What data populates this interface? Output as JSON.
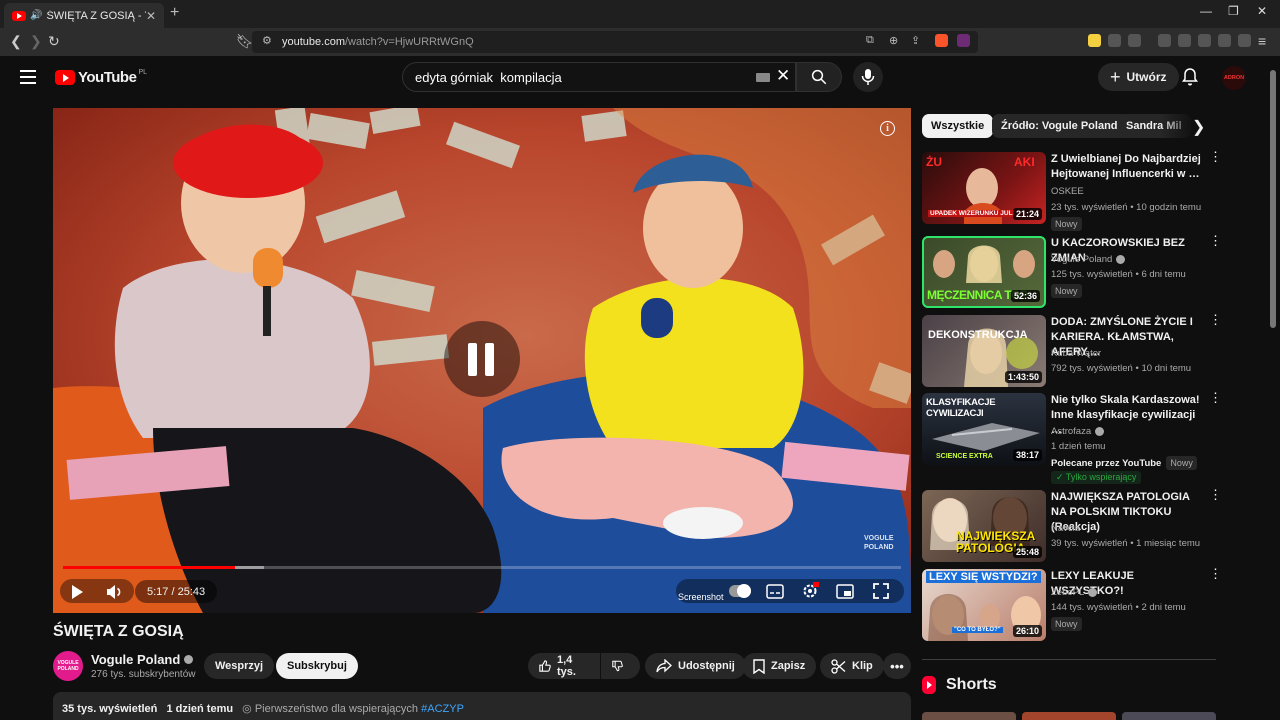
{
  "browser": {
    "tab_title": "ŚWIĘTA Z GOSIĄ - YouTube",
    "url_host": "youtube.com",
    "url_path": "/watch?v=HjwURRtWGnQ"
  },
  "header": {
    "logo_text": "YouTube",
    "region": "PL",
    "search_value": "edyta górniak  kompilacja",
    "create_label": "Utwórz",
    "account_initials": "ADRON"
  },
  "player": {
    "current_time": "5:17",
    "duration": "25:43",
    "time_separator": " / ",
    "progress_fraction": 0.205,
    "buffered_fraction": 0.24,
    "screenshot_label": "Screenshot",
    "watermark_line1": "VOGULE",
    "watermark_line2": "POLAND",
    "state": "playing"
  },
  "video": {
    "title": "ŚWIĘTA Z GOSIĄ",
    "channel": "Vogule Poland",
    "channel_avatar_text": "VOGULE POLAND",
    "subscribers": "276 tys. subskrybentów",
    "support_label": "Wesprzyj",
    "subscribe_label": "Subskrybuj",
    "likes": "1,4 tys.",
    "share_label": "Udostępnij",
    "save_label": "Zapisz",
    "clip_label": "Klip",
    "views": "35 tys. wyświetleń",
    "published": "1 dzień temu",
    "members_first": "Pierwszeństwo dla wspierających",
    "hashtag": "#ACZYP"
  },
  "sidebar": {
    "chips": [
      "Wszystkie",
      "Źródło: Vogule Poland",
      "Sandra Mil"
    ],
    "recommendations": [
      {
        "title": "Z Uwielbianej Do Najbardziej Hejtowanej Influencerki w …",
        "channel": "OSKEE",
        "meta": "23 tys. wyświetleń • 10 godzin temu",
        "badge": "Nowy",
        "duration": "21:24",
        "thumb_text": "UPADEK WIZERUNKU JULI"
      },
      {
        "title": "U KACZOROWSKIEJ BEZ ZMIAN",
        "channel": "Vogule Poland",
        "meta": "125 tys. wyświetleń • 6 dni temu",
        "badge": "Nowy",
        "duration": "52:36",
        "thumb_text": "MĘCZENNICA TOP"
      },
      {
        "title": "DODA: ZMYŚLONE ŻYCIE I KARIERA. KŁAMSTWA, AFERY,…",
        "channel": "Kuba Wątor",
        "meta": "792 tys. wyświetleń • 10 dni temu",
        "duration": "1:43:50",
        "thumb_text": "DEKONSTRUKCJA"
      },
      {
        "title": "Nie tylko Skala Kardaszowa! Inne klasyfikacje cywilizacji …",
        "channel": "Astrofaza",
        "meta": "1 dzień temu",
        "promo": "Polecane przez YouTube",
        "badge": "Nowy",
        "member": "Tylko wspierający",
        "duration": "38:17",
        "thumb_text": "KLASYFIKACJE CYWILIZACJI",
        "thumb_text2": "SCIENCE EXTRA"
      },
      {
        "title": "NAJWIĘKSZA PATOLOGIA NA POLSKIM TIKTOKU (Reakcja)",
        "channel": "Navcia",
        "meta": "39 tys. wyświetleń • 1 miesiąc temu",
        "duration": "25:48",
        "thumb_text": "NAJWIĘKSZA PATOLOGIA"
      },
      {
        "title": "LEXY LEAKUJE WSZYSTKO?!",
        "channel": "ZeboPL",
        "meta": "144 tys. wyświetleń • 2 dni temu",
        "badge": "Nowy",
        "duration": "26:10",
        "thumb_text": "LEXY SIĘ WSTYDZI?",
        "thumb_text2": "\"CO TO BYŁO?\""
      }
    ],
    "shorts_label": "Shorts"
  },
  "colors": {
    "brand_red": "#ff0000",
    "background": "#0f0f0f",
    "chip_bg": "#272727"
  }
}
